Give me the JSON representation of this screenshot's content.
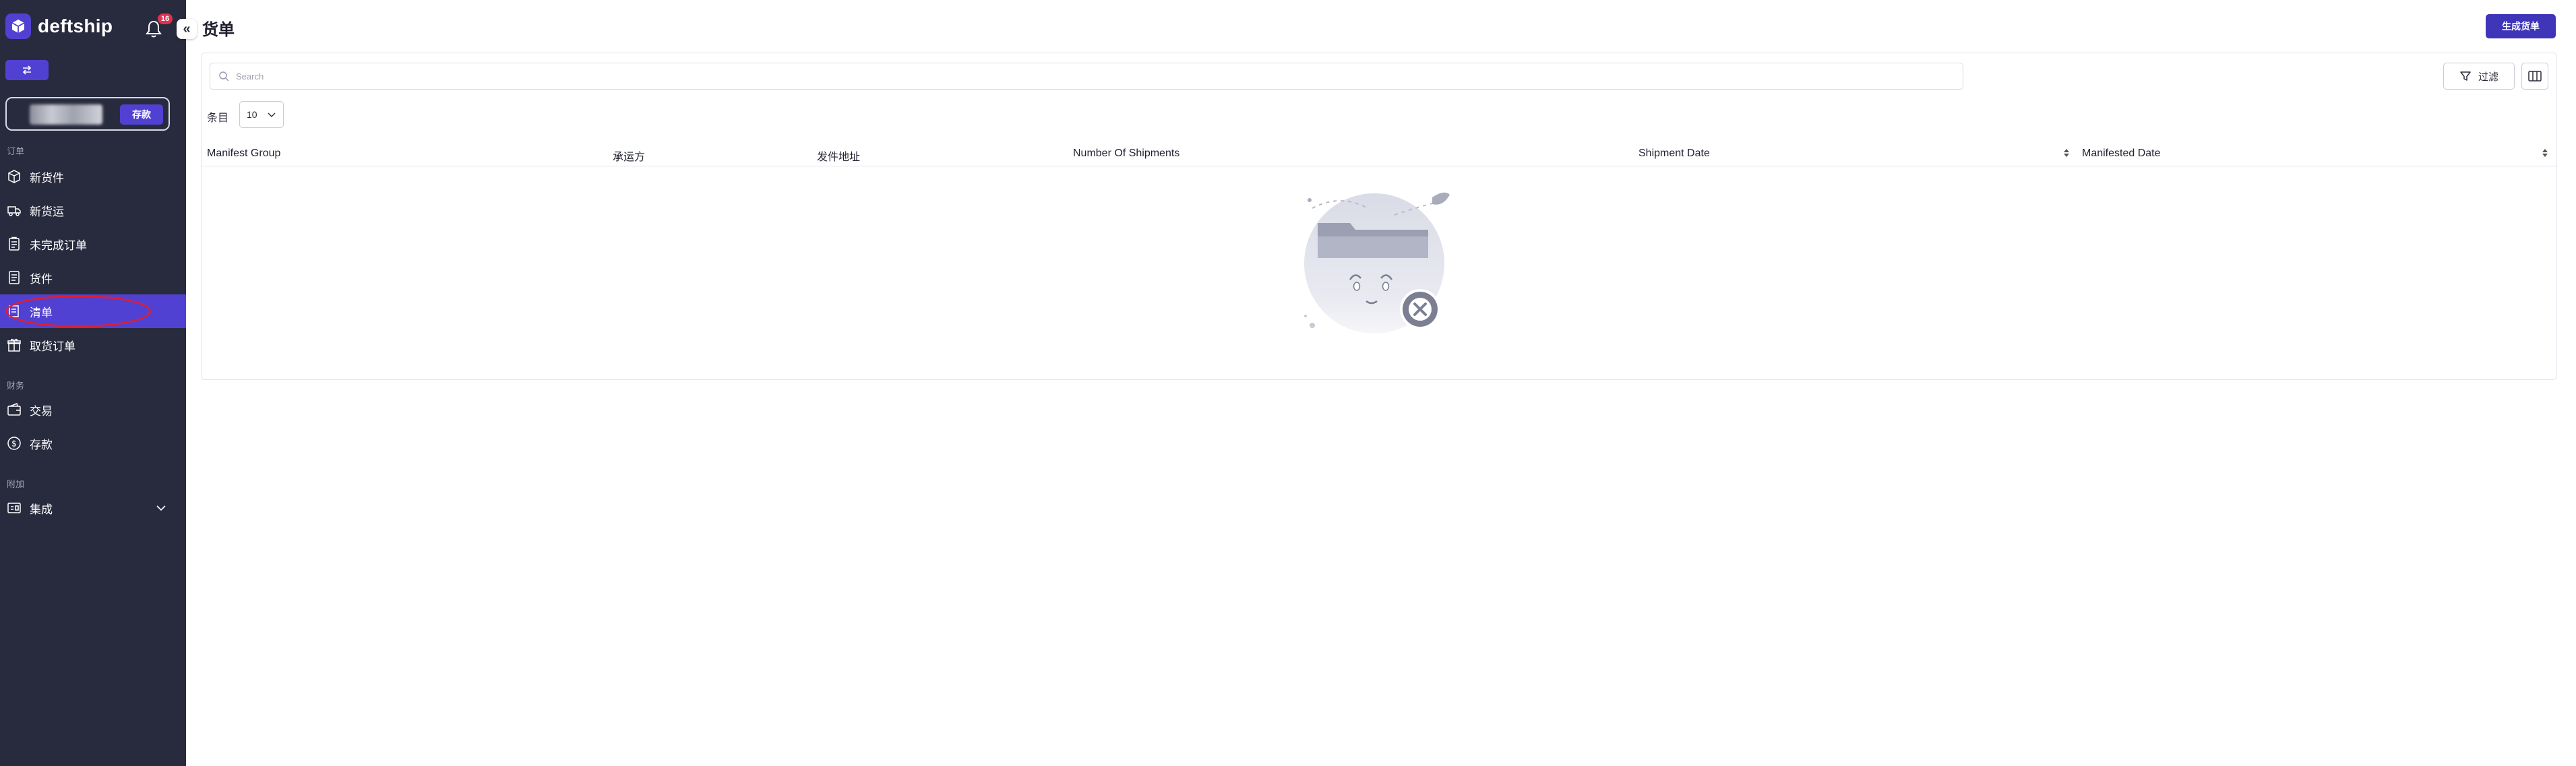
{
  "sidebar": {
    "brand_name": "deftship",
    "notification_count": "16",
    "collapse_glyph": "«",
    "deposit_label": "存款",
    "sections": [
      {
        "label": "订单"
      },
      {
        "label": "财务"
      },
      {
        "label": "附加"
      }
    ],
    "items": [
      {
        "label": "新货件",
        "icon": "box-icon"
      },
      {
        "label": "新货运",
        "icon": "truck-icon"
      },
      {
        "label": "未完成订单",
        "icon": "clipboard-icon"
      },
      {
        "label": "货件",
        "icon": "document-icon"
      },
      {
        "label": "清单",
        "icon": "manifest-icon",
        "active": true
      },
      {
        "label": "取货订单",
        "icon": "gift-box-icon"
      },
      {
        "label": "交易",
        "icon": "wallet-icon"
      },
      {
        "label": "存款",
        "icon": "dollar-circle-icon"
      },
      {
        "label": "集成",
        "icon": "integration-icon",
        "expandable": true
      }
    ]
  },
  "header": {
    "title": "货单",
    "primary_action": "生成货单"
  },
  "toolbar": {
    "search_placeholder": "Search",
    "filter_label": "过滤",
    "rows_label": "条目",
    "rows_per_page": "10"
  },
  "table": {
    "columns": [
      {
        "label": "Manifest Group",
        "sortable": false
      },
      {
        "label": "承运方",
        "sortable": false
      },
      {
        "label": "发件地址",
        "sortable": false
      },
      {
        "label": "Number Of Shipments",
        "sortable": false
      },
      {
        "label": "Shipment Date",
        "sortable": true
      },
      {
        "label": "Manifested Date",
        "sortable": true
      }
    ],
    "rows": []
  },
  "colors": {
    "sidebar_bg": "#282b3e",
    "accent": "#5141d2",
    "primary_button": "#3f35b8",
    "badge": "#e0314f",
    "annotation": "#e11d2f"
  }
}
